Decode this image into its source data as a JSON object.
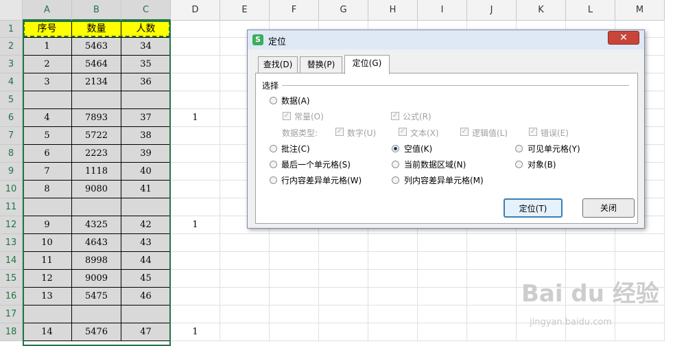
{
  "columns": [
    "A",
    "B",
    "C",
    "D",
    "E",
    "F",
    "G",
    "H",
    "I",
    "J",
    "K",
    "L",
    "M"
  ],
  "rows": [
    "1",
    "2",
    "3",
    "4",
    "5",
    "6",
    "7",
    "8",
    "9",
    "10",
    "11",
    "12",
    "13",
    "14",
    "15",
    "16",
    "17",
    "18"
  ],
  "headers": [
    "序号",
    "数量",
    "人数"
  ],
  "table": [
    [
      "1",
      "5463",
      "34",
      ""
    ],
    [
      "2",
      "5464",
      "35",
      ""
    ],
    [
      "3",
      "2134",
      "36",
      ""
    ],
    [
      "",
      "",
      "",
      ""
    ],
    [
      "4",
      "7893",
      "37",
      "1"
    ],
    [
      "5",
      "5722",
      "38",
      ""
    ],
    [
      "6",
      "2223",
      "39",
      ""
    ],
    [
      "7",
      "1118",
      "40",
      ""
    ],
    [
      "8",
      "9080",
      "41",
      ""
    ],
    [
      "",
      "",
      "",
      ""
    ],
    [
      "9",
      "4325",
      "42",
      "1"
    ],
    [
      "10",
      "4643",
      "43",
      ""
    ],
    [
      "11",
      "8998",
      "44",
      ""
    ],
    [
      "12",
      "9009",
      "45",
      ""
    ],
    [
      "13",
      "5475",
      "46",
      ""
    ],
    [
      "",
      "",
      "",
      ""
    ],
    [
      "14",
      "5476",
      "47",
      "1"
    ]
  ],
  "dialog": {
    "app_icon": "S",
    "title": "定位",
    "close": "✕",
    "tabs": [
      "查找(D)",
      "替换(P)",
      "定位(G)"
    ],
    "group": "选择",
    "opt_data": "数据(A)",
    "opt_constant": "常量(O)",
    "opt_formula": "公式(R)",
    "data_type_label": "数据类型:",
    "opt_number": "数字(U)",
    "opt_text": "文本(X)",
    "opt_logical": "逻辑值(L)",
    "opt_error": "错误(E)",
    "opt_comment": "批注(C)",
    "opt_blank": "空值(K)",
    "opt_visible": "可见单元格(Y)",
    "opt_last": "最后一个单元格(S)",
    "opt_region": "当前数据区域(N)",
    "opt_object": "对象(B)",
    "opt_rowdiff": "行内容差异单元格(W)",
    "opt_coldiff": "列内容差异单元格(M)",
    "btn_locate": "定位(T)",
    "btn_close": "关闭"
  },
  "watermark": "Bai du 经验",
  "watermark_url": "jingyan.baidu.com"
}
